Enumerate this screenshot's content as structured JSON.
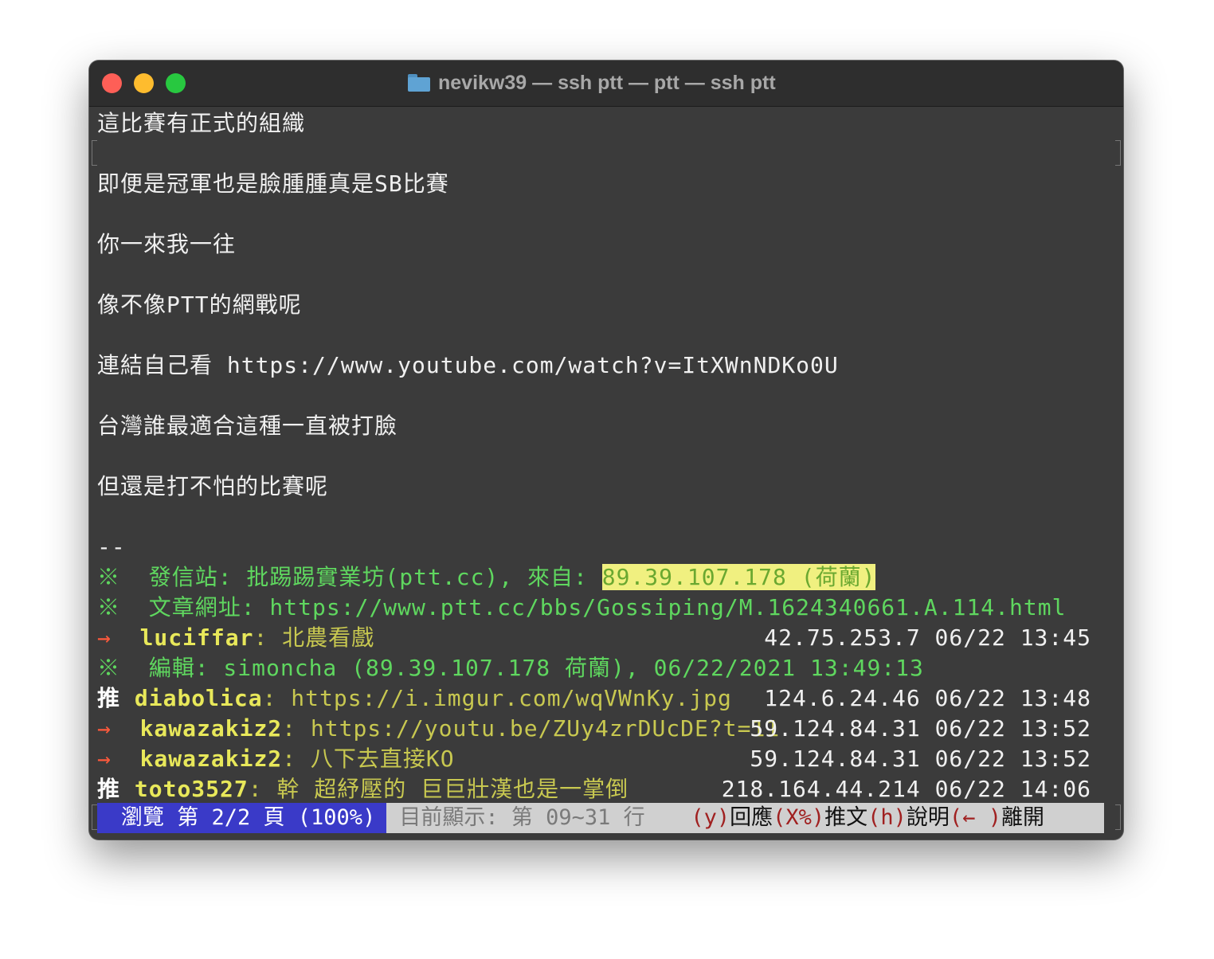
{
  "window": {
    "title": "nevikw39 — ssh ptt — ptt — ssh ptt"
  },
  "content": {
    "lines": [
      "這比賽有正式的組織",
      "即便是冠軍也是臉腫腫真是SB比賽",
      "你一來我一往",
      "像不像PTT的網戰呢",
      "連結自己看 https://www.youtube.com/watch?v=ItXWnNDKo0U",
      "台灣誰最適合這種一直被打臉",
      "但還是打不怕的比賽呢"
    ],
    "signature_separator": "--"
  },
  "footer": {
    "sent_prefix": "※  發信站: 批踢踢實業坊(ptt.cc), 來自: ",
    "sent_ip": "89.39.107.178 (荷蘭)",
    "url_line": "※  文章網址: https://www.ptt.cc/bbs/Gossiping/M.1624340661.A.114.html",
    "edit_line": "※  編輯: simoncha (89.39.107.178 荷蘭), 06/22/2021 13:49:13"
  },
  "pushes": [
    {
      "tag": "→",
      "user": "luciffar",
      "text": ": 北農看戲",
      "meta": "42.75.253.7 06/22 13:45",
      "tag_type": "arrow"
    },
    {
      "tag": "推",
      "user": "diabolica",
      "text": ": https://i.imgur.com/wqVWnKy.jpg",
      "meta": "124.6.24.46 06/22 13:48",
      "tag_type": "push"
    },
    {
      "tag": "→",
      "user": "kawazakiz2",
      "text": ": https://youtu.be/ZUy4zrDUcDE?t=11",
      "meta": "59.124.84.31 06/22 13:52",
      "tag_type": "arrow"
    },
    {
      "tag": "→",
      "user": "kawazakiz2",
      "text": ": 八下去直接KO",
      "meta": "59.124.84.31 06/22 13:52",
      "tag_type": "arrow"
    },
    {
      "tag": "推",
      "user": "toto3527",
      "text": ": 幹 超紓壓的 巨巨壯漢也是一掌倒",
      "meta": "218.164.44.214 06/22 14:06",
      "tag_type": "push"
    }
  ],
  "status": {
    "page": "瀏覽 第 2/2 頁 (100%)",
    "info": "目前顯示: 第 09~31 行",
    "keys": [
      {
        "key": "(y)",
        "label": "回應"
      },
      {
        "key": "(X%)",
        "label": "推文"
      },
      {
        "key": "(h)",
        "label": "說明"
      },
      {
        "key": "(← )",
        "label": "離開"
      }
    ]
  }
}
